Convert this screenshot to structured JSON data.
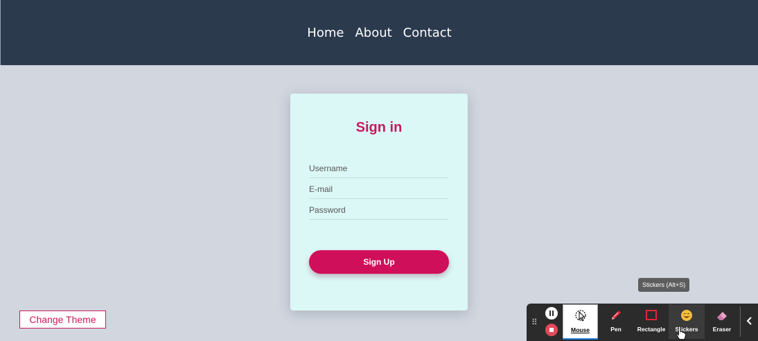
{
  "nav": {
    "links": [
      "Home",
      "About",
      "Contact"
    ]
  },
  "signin": {
    "title": "Sign in",
    "username_placeholder": "Username",
    "email_placeholder": "E-mail",
    "password_placeholder": "Password",
    "submit_label": "Sign Up"
  },
  "theme_button": "Change Theme",
  "tooltip": "Stickers (Alt+S)",
  "toolbar": {
    "tools": [
      {
        "label": "Mouse",
        "icon": "mouse-cursor-icon",
        "active": true
      },
      {
        "label": "Pen",
        "icon": "pen-icon"
      },
      {
        "label": "Rectangle",
        "icon": "rectangle-icon"
      },
      {
        "label": "Stickers",
        "icon": "sticker-icon"
      },
      {
        "label": "Eraser",
        "icon": "eraser-icon"
      }
    ]
  },
  "colors": {
    "navbar_bg": "#2c3a4e",
    "page_bg": "#d1d6df",
    "card_bg": "#dcf8f6",
    "accent": "#c8195a",
    "button_bg": "#cf0f59",
    "toolbar_bg": "#2b2b2b"
  }
}
